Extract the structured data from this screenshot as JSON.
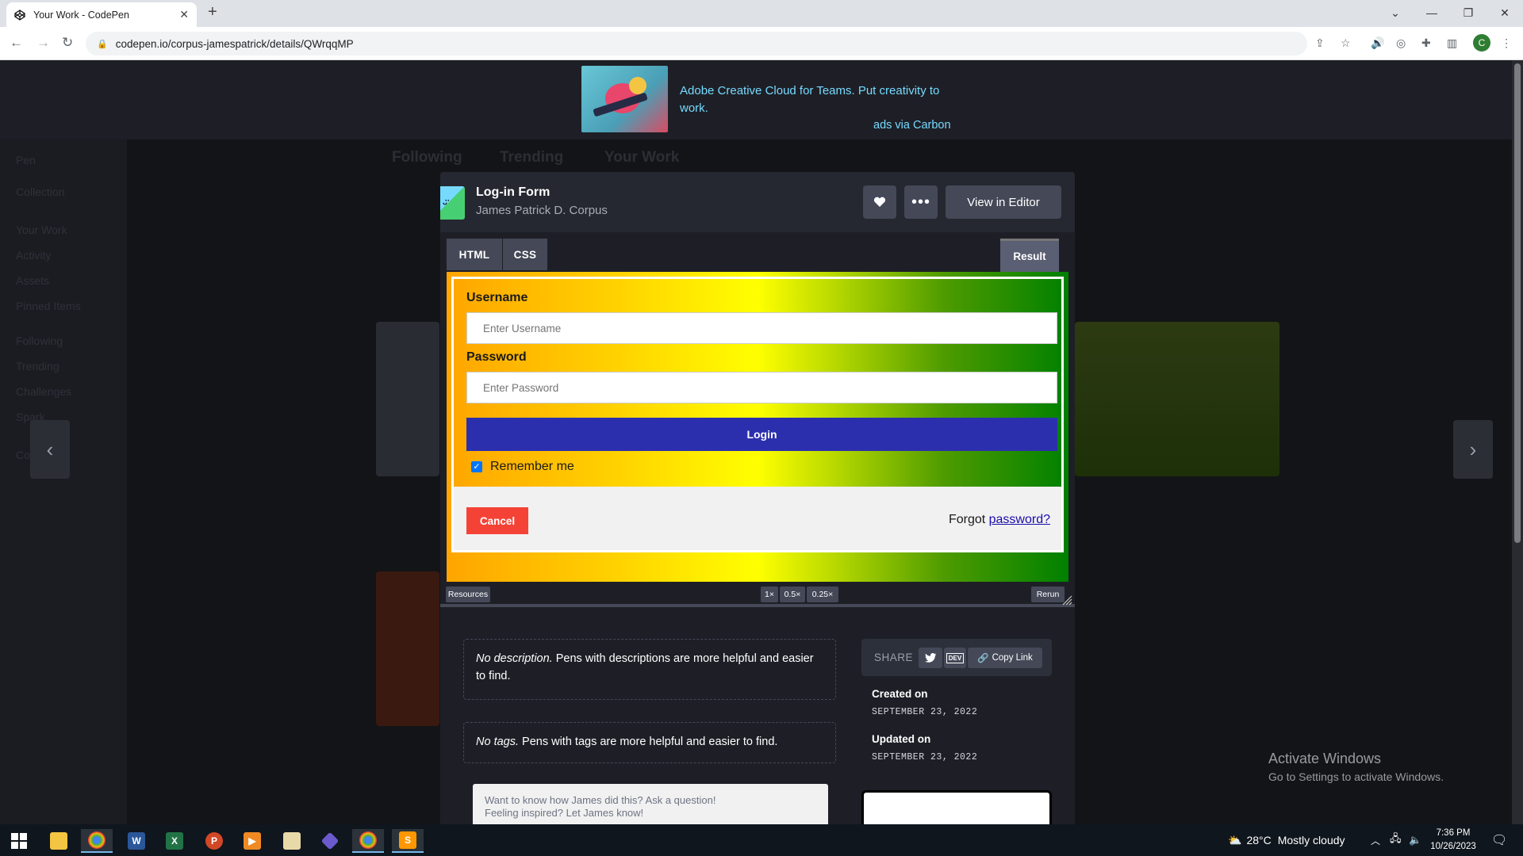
{
  "browser": {
    "tab_title": "Your Work - CodePen",
    "tab_close": "✕",
    "new_tab": "+",
    "url": "codepen.io/corpus-jamespatrick/details/QWrqqMP",
    "profile_initial": "C"
  },
  "ad": {
    "text": "Adobe Creative Cloud for Teams. Put creativity to work.",
    "via": "ads via Carbon"
  },
  "background": {
    "nav_tabs": [
      "Following",
      "Trending",
      "Your Work"
    ],
    "sidebar": [
      "Pen",
      "Collection",
      "Your Work",
      "Activity",
      "Assets",
      "Pinned Items",
      "Following",
      "Trending",
      "Challenges",
      "Spark",
      "CodePen"
    ]
  },
  "pen": {
    "title": "Log-in Form",
    "author": "James Patrick D. Corpus",
    "view_editor": "View in Editor",
    "tabs": [
      "HTML",
      "CSS"
    ],
    "result_tab": "Result"
  },
  "form": {
    "username_label": "Username",
    "username_placeholder": "Enter Username",
    "password_label": "Password",
    "password_placeholder": "Enter Password",
    "login_label": "Login",
    "remember_label": "Remember me",
    "remember_checked": true,
    "cancel_label": "Cancel",
    "forgot_prefix": "Forgot ",
    "forgot_link": "password?"
  },
  "preview_bar": {
    "resources": "Resources",
    "zoom": [
      "1×",
      "0.5×",
      "0.25×"
    ],
    "rerun": "Rerun"
  },
  "details": {
    "desc_em": "No description.",
    "desc_text": " Pens with descriptions are more helpful and easier to find.",
    "tags_em": "No tags.",
    "tags_text": " Pens with tags are more helpful and easier to find.",
    "ask_line1": "Want to know how James did this? Ask a question!",
    "ask_line2": "Feeling inspired? Let James know!",
    "share_label": "SHARE",
    "dev_label": "DEV",
    "copy_link": "Copy Link",
    "created_label": "Created on",
    "created_date": "SEPTEMBER 23, 2022",
    "updated_label": "Updated on",
    "updated_date": "SEPTEMBER 23, 2022"
  },
  "watermark": {
    "title": "Activate Windows",
    "subtitle": "Go to Settings to activate Windows."
  },
  "taskbar": {
    "weather_temp": "28°C",
    "weather_desc": "Mostly cloudy",
    "time": "7:36 PM",
    "date": "10/26/2023"
  }
}
